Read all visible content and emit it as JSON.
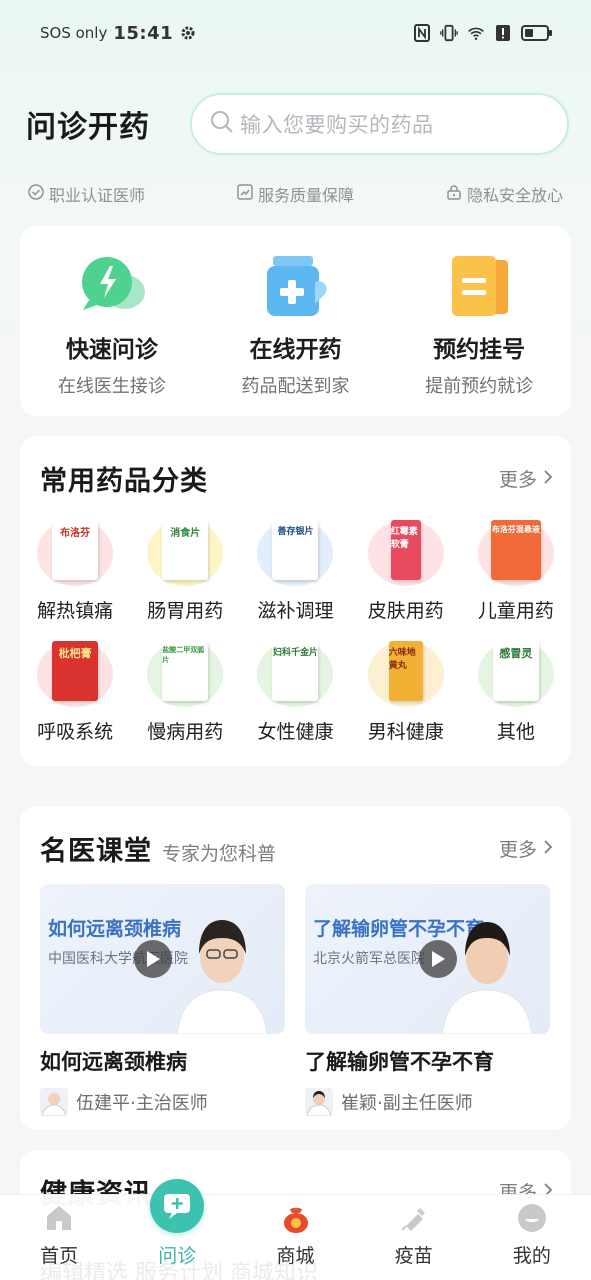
{
  "status_bar": {
    "carrier": "SOS only",
    "time": "15:41",
    "icons": [
      "settings-icon",
      "nfc-icon",
      "vibrate-icon",
      "wifi-icon",
      "alert-icon",
      "battery-icon"
    ]
  },
  "header": {
    "title": "问诊开药",
    "search_placeholder": "输入您要购买的药品"
  },
  "assurance": [
    {
      "label": "职业认证医师",
      "icon": "check-circle-icon"
    },
    {
      "label": "服务质量保障",
      "icon": "chart-icon"
    },
    {
      "label": "隐私安全放心",
      "icon": "lock-icon"
    }
  ],
  "services": [
    {
      "title": "快速问诊",
      "sub": "在线医生接诊",
      "icon": "lightning-chat-icon"
    },
    {
      "title": "在线开药",
      "sub": "药品配送到家",
      "icon": "medicine-bottle-icon"
    },
    {
      "title": "预约挂号",
      "sub": "提前预约就诊",
      "icon": "appointment-card-icon"
    }
  ],
  "categories": {
    "title": "常用药品分类",
    "more": "更多",
    "items": [
      {
        "label": "解热镇痛",
        "box_text": "布洛芬"
      },
      {
        "label": "肠胃用药",
        "box_text": "消食片"
      },
      {
        "label": "滋补调理",
        "box_text": "善存银片"
      },
      {
        "label": "皮肤用药",
        "box_text": "红霉素软膏"
      },
      {
        "label": "儿童用药",
        "box_text": "布洛芬混悬液"
      },
      {
        "label": "呼吸系统",
        "box_text": "枇杷膏"
      },
      {
        "label": "慢病用药",
        "box_text": "盐酸二甲双胍片"
      },
      {
        "label": "女性健康",
        "box_text": "妇科千金片"
      },
      {
        "label": "男科健康",
        "box_text": "六味地黄丸"
      },
      {
        "label": "其他",
        "box_text": "感冒灵"
      }
    ]
  },
  "lectures": {
    "title": "名医课堂",
    "subtitle": "专家为您科普",
    "more": "更多",
    "videos": [
      {
        "thumb_title": "如何远离颈椎病",
        "org": "中国医科大学航天医院",
        "title": "如何远离颈椎病",
        "doctor": "伍建平·主治医师"
      },
      {
        "thumb_title": "了解输卵管不孕不育",
        "org": "北京火箭军总医院",
        "title": "了解输卵管不孕不育",
        "doctor": "崔颖·副主任医师"
      }
    ]
  },
  "news": {
    "title": "健康资讯",
    "more": "更多",
    "tabs_hint": "编辑精选  服务计划  商城知识"
  },
  "tabbar": [
    {
      "label": "首页",
      "icon": "home-icon"
    },
    {
      "label": "问诊",
      "icon": "consult-icon",
      "active": true
    },
    {
      "label": "商城",
      "icon": "shop-bag-icon"
    },
    {
      "label": "疫苗",
      "icon": "vaccine-icon"
    },
    {
      "label": "我的",
      "icon": "profile-icon"
    }
  ],
  "colors": {
    "accent": "#3dc2b0",
    "background": "#f5f6f7"
  }
}
